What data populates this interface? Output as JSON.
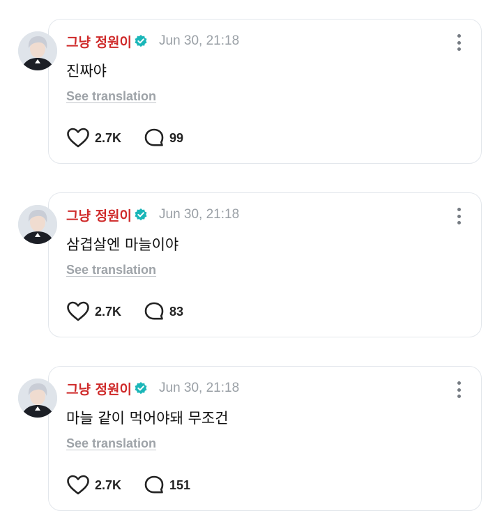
{
  "colors": {
    "name": "#cf2a2a",
    "verified_badge": "#1ab6b8",
    "timestamp": "#9aa0a6"
  },
  "posts": [
    {
      "author": "그냥 정원이",
      "verified_icon": "verified-badge-icon",
      "timestamp": "Jun 30, 21:18",
      "body": "진짜야",
      "translate_label": "See translation",
      "likes": "2.7K",
      "comments": "99"
    },
    {
      "author": "그냥 정원이",
      "verified_icon": "verified-badge-icon",
      "timestamp": "Jun 30, 21:18",
      "body": "삼겹살엔 마늘이야",
      "translate_label": "See translation",
      "likes": "2.7K",
      "comments": "83"
    },
    {
      "author": "그냥 정원이",
      "verified_icon": "verified-badge-icon",
      "timestamp": "Jun 30, 21:18",
      "body": "마늘 같이 먹어야돼 무조건",
      "translate_label": "See translation",
      "likes": "2.7K",
      "comments": "151"
    }
  ]
}
